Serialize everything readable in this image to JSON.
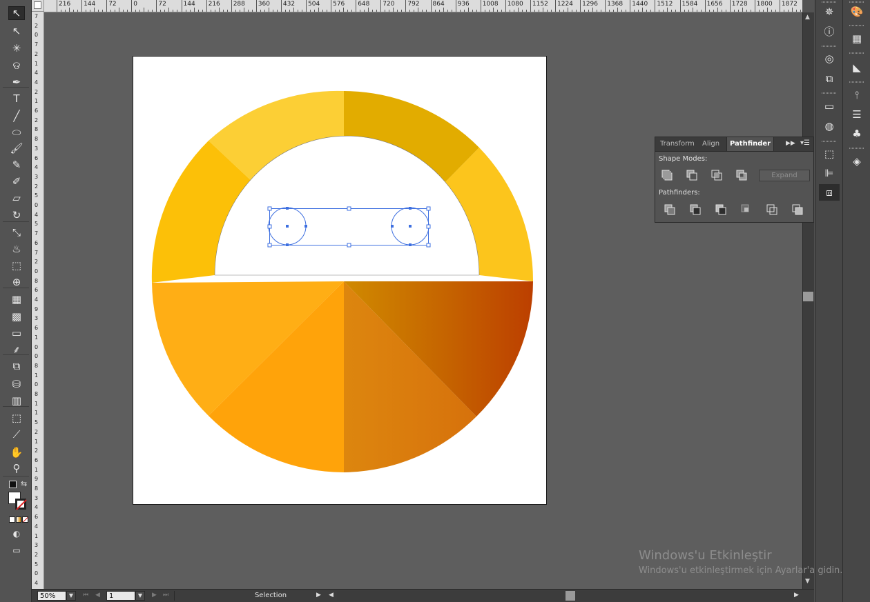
{
  "ruler": {
    "top_ticks": [
      "216",
      "144",
      "72",
      "0",
      "72",
      "144",
      "216",
      "288",
      "360",
      "432",
      "504",
      "576",
      "648",
      "720",
      "792",
      "864",
      "936",
      "1008",
      "1080",
      "1152",
      "1224",
      "1296",
      "1368",
      "1440",
      "1512",
      "1584",
      "1656",
      "1728",
      "1800",
      "1872"
    ],
    "left_digits": [
      "7",
      "2",
      "0",
      "7",
      "2",
      "1",
      "4",
      "4",
      "2",
      "1",
      "6",
      "2",
      "8",
      "8",
      "3",
      "6",
      "4",
      "3",
      "2",
      "5",
      "0",
      "4",
      "5",
      "7",
      "6",
      "7",
      "2",
      "0",
      "8",
      "6",
      "4",
      "9",
      "3",
      "6",
      "1",
      "0",
      "0",
      "8",
      "1",
      "0",
      "8",
      "1",
      "1",
      "5",
      "2",
      "1",
      "2",
      "6",
      "1",
      "9",
      "8",
      "3",
      "4",
      "6",
      "4",
      "1",
      "3",
      "2",
      "5",
      "0",
      "4"
    ]
  },
  "toolbar": {
    "tools": [
      {
        "name": "selection-tool",
        "glyph": "↖"
      },
      {
        "name": "direct-selection-tool",
        "glyph": "↖"
      },
      {
        "name": "magic-wand-tool",
        "glyph": "✳"
      },
      {
        "name": "lasso-tool",
        "glyph": "ଡ"
      },
      {
        "name": "pen-tool",
        "glyph": "✒"
      },
      {
        "name": "type-tool",
        "glyph": "T"
      },
      {
        "name": "line-segment-tool",
        "glyph": "╱"
      },
      {
        "name": "ellipse-tool",
        "glyph": "⬭"
      },
      {
        "name": "paintbrush-tool",
        "glyph": "🖌"
      },
      {
        "name": "pencil-tool",
        "glyph": "✎"
      },
      {
        "name": "blob-brush-tool",
        "glyph": "✐"
      },
      {
        "name": "eraser-tool",
        "glyph": "▱"
      },
      {
        "name": "rotate-tool",
        "glyph": "↻"
      },
      {
        "name": "scale-tool",
        "glyph": "⤡"
      },
      {
        "name": "warp-tool",
        "glyph": "♨"
      },
      {
        "name": "free-transform-tool",
        "glyph": "⬚"
      },
      {
        "name": "shape-builder-tool",
        "glyph": "⊕"
      },
      {
        "name": "perspective-grid-tool",
        "glyph": "▦"
      },
      {
        "name": "mesh-tool",
        "glyph": "▩"
      },
      {
        "name": "gradient-tool",
        "glyph": "▭"
      },
      {
        "name": "eyedropper-tool",
        "glyph": "⸙"
      },
      {
        "name": "blend-tool",
        "glyph": "⧉"
      },
      {
        "name": "symbol-sprayer-tool",
        "glyph": "⛁"
      },
      {
        "name": "column-graph-tool",
        "glyph": "▥"
      },
      {
        "name": "artboard-tool",
        "glyph": "⬚"
      },
      {
        "name": "slice-tool",
        "glyph": "⟋"
      },
      {
        "name": "hand-tool",
        "glyph": "✋"
      },
      {
        "name": "zoom-tool",
        "glyph": "⚲"
      }
    ]
  },
  "status": {
    "zoom": "50%",
    "artboard_number": "1",
    "current_tool": "Selection"
  },
  "pathfinder_panel": {
    "tabs": [
      "Transform",
      "Align",
      "Pathfinder"
    ],
    "active_tab": "Pathfinder",
    "shape_modes_label": "Shape Modes:",
    "pathfinders_label": "Pathfinders:",
    "expand_label": "Expand"
  },
  "dock": {
    "column1": [
      "transform-icon",
      "info-icon",
      "appearance-icon",
      "artboards-icon",
      "gradient-icon",
      "transparency-icon",
      "align-icon",
      "pathfinder-icon"
    ],
    "column2": [
      "color-guide-icon",
      "swatches-icon",
      "navigator-icon",
      "brushes-icon",
      "stroke-icon",
      "symbols-icon",
      "layers-icon"
    ]
  },
  "watermark": {
    "title": "Windows'u Etkinleştir",
    "subtitle": "Windows'u etkinleştirmek için Ayarlar'a gidin."
  },
  "colors": {
    "ring_yellow_light": "#fccf35",
    "ring_gold": "#e2ac00",
    "ring_yellow": "#fcc008",
    "orange_light": "#ffae15",
    "orange": "#ffa30a",
    "orange_dark": "#d9810f",
    "rust": "#bc3f00",
    "selection_blue": "#3d6fe0"
  }
}
